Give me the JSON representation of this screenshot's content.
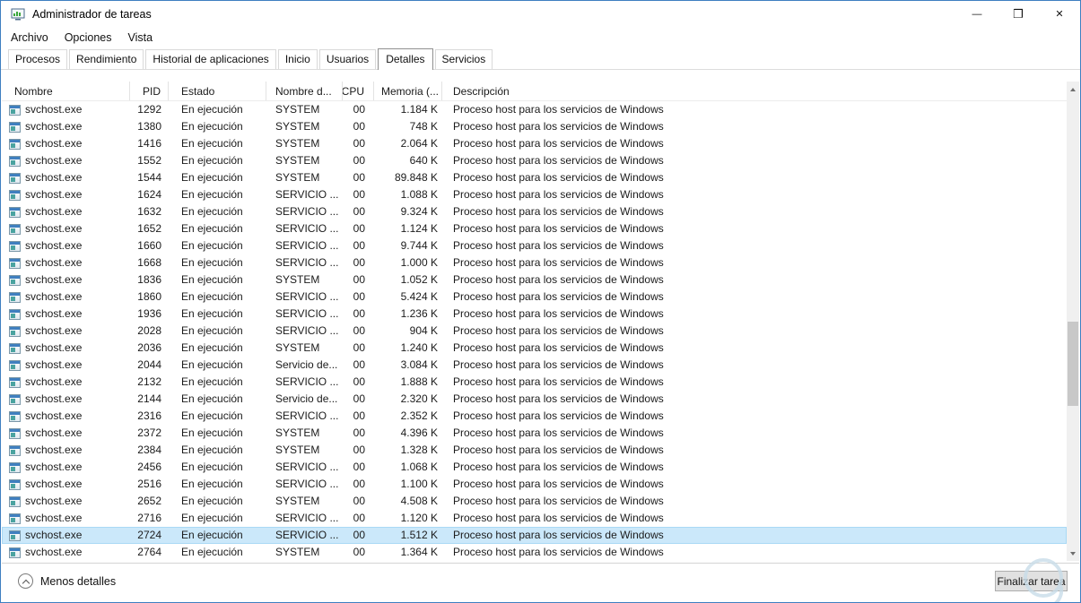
{
  "window": {
    "title": "Administrador de tareas",
    "controls": {
      "minimize": "—",
      "maximize": "❒",
      "close": "✕"
    }
  },
  "menu": {
    "items": [
      "Archivo",
      "Opciones",
      "Vista"
    ]
  },
  "tabs": {
    "items": [
      "Procesos",
      "Rendimiento",
      "Historial de aplicaciones",
      "Inicio",
      "Usuarios",
      "Detalles",
      "Servicios"
    ],
    "active": "Detalles"
  },
  "table": {
    "columns": [
      "Nombre",
      "PID",
      "Estado",
      "Nombre d...",
      "CPU",
      "Memoria (...",
      "Descripción"
    ],
    "sort": {
      "column": "Nombre",
      "direction": "asc",
      "glyph": "ˆ"
    },
    "rows": [
      {
        "name": "svchost.exe",
        "pid": "1292",
        "status": "En ejecución",
        "user": "SYSTEM",
        "cpu": "00",
        "memory": "1.184 K",
        "description": "Proceso host para los servicios de Windows",
        "selected": false
      },
      {
        "name": "svchost.exe",
        "pid": "1380",
        "status": "En ejecución",
        "user": "SYSTEM",
        "cpu": "00",
        "memory": "748 K",
        "description": "Proceso host para los servicios de Windows",
        "selected": false
      },
      {
        "name": "svchost.exe",
        "pid": "1416",
        "status": "En ejecución",
        "user": "SYSTEM",
        "cpu": "00",
        "memory": "2.064 K",
        "description": "Proceso host para los servicios de Windows",
        "selected": false
      },
      {
        "name": "svchost.exe",
        "pid": "1552",
        "status": "En ejecución",
        "user": "SYSTEM",
        "cpu": "00",
        "memory": "640 K",
        "description": "Proceso host para los servicios de Windows",
        "selected": false
      },
      {
        "name": "svchost.exe",
        "pid": "1544",
        "status": "En ejecución",
        "user": "SYSTEM",
        "cpu": "00",
        "memory": "89.848 K",
        "description": "Proceso host para los servicios de Windows",
        "selected": false
      },
      {
        "name": "svchost.exe",
        "pid": "1624",
        "status": "En ejecución",
        "user": "SERVICIO ...",
        "cpu": "00",
        "memory": "1.088 K",
        "description": "Proceso host para los servicios de Windows",
        "selected": false
      },
      {
        "name": "svchost.exe",
        "pid": "1632",
        "status": "En ejecución",
        "user": "SERVICIO ...",
        "cpu": "00",
        "memory": "9.324 K",
        "description": "Proceso host para los servicios de Windows",
        "selected": false
      },
      {
        "name": "svchost.exe",
        "pid": "1652",
        "status": "En ejecución",
        "user": "SERVICIO ...",
        "cpu": "00",
        "memory": "1.124 K",
        "description": "Proceso host para los servicios de Windows",
        "selected": false
      },
      {
        "name": "svchost.exe",
        "pid": "1660",
        "status": "En ejecución",
        "user": "SERVICIO ...",
        "cpu": "00",
        "memory": "9.744 K",
        "description": "Proceso host para los servicios de Windows",
        "selected": false
      },
      {
        "name": "svchost.exe",
        "pid": "1668",
        "status": "En ejecución",
        "user": "SERVICIO ...",
        "cpu": "00",
        "memory": "1.000 K",
        "description": "Proceso host para los servicios de Windows",
        "selected": false
      },
      {
        "name": "svchost.exe",
        "pid": "1836",
        "status": "En ejecución",
        "user": "SYSTEM",
        "cpu": "00",
        "memory": "1.052 K",
        "description": "Proceso host para los servicios de Windows",
        "selected": false
      },
      {
        "name": "svchost.exe",
        "pid": "1860",
        "status": "En ejecución",
        "user": "SERVICIO ...",
        "cpu": "00",
        "memory": "5.424 K",
        "description": "Proceso host para los servicios de Windows",
        "selected": false
      },
      {
        "name": "svchost.exe",
        "pid": "1936",
        "status": "En ejecución",
        "user": "SERVICIO ...",
        "cpu": "00",
        "memory": "1.236 K",
        "description": "Proceso host para los servicios de Windows",
        "selected": false
      },
      {
        "name": "svchost.exe",
        "pid": "2028",
        "status": "En ejecución",
        "user": "SERVICIO ...",
        "cpu": "00",
        "memory": "904 K",
        "description": "Proceso host para los servicios de Windows",
        "selected": false
      },
      {
        "name": "svchost.exe",
        "pid": "2036",
        "status": "En ejecución",
        "user": "SYSTEM",
        "cpu": "00",
        "memory": "1.240 K",
        "description": "Proceso host para los servicios de Windows",
        "selected": false
      },
      {
        "name": "svchost.exe",
        "pid": "2044",
        "status": "En ejecución",
        "user": "Servicio de...",
        "cpu": "00",
        "memory": "3.084 K",
        "description": "Proceso host para los servicios de Windows",
        "selected": false
      },
      {
        "name": "svchost.exe",
        "pid": "2132",
        "status": "En ejecución",
        "user": "SERVICIO ...",
        "cpu": "00",
        "memory": "1.888 K",
        "description": "Proceso host para los servicios de Windows",
        "selected": false
      },
      {
        "name": "svchost.exe",
        "pid": "2144",
        "status": "En ejecución",
        "user": "Servicio de...",
        "cpu": "00",
        "memory": "2.320 K",
        "description": "Proceso host para los servicios de Windows",
        "selected": false
      },
      {
        "name": "svchost.exe",
        "pid": "2316",
        "status": "En ejecución",
        "user": "SERVICIO ...",
        "cpu": "00",
        "memory": "2.352 K",
        "description": "Proceso host para los servicios de Windows",
        "selected": false
      },
      {
        "name": "svchost.exe",
        "pid": "2372",
        "status": "En ejecución",
        "user": "SYSTEM",
        "cpu": "00",
        "memory": "4.396 K",
        "description": "Proceso host para los servicios de Windows",
        "selected": false
      },
      {
        "name": "svchost.exe",
        "pid": "2384",
        "status": "En ejecución",
        "user": "SYSTEM",
        "cpu": "00",
        "memory": "1.328 K",
        "description": "Proceso host para los servicios de Windows",
        "selected": false
      },
      {
        "name": "svchost.exe",
        "pid": "2456",
        "status": "En ejecución",
        "user": "SERVICIO ...",
        "cpu": "00",
        "memory": "1.068 K",
        "description": "Proceso host para los servicios de Windows",
        "selected": false
      },
      {
        "name": "svchost.exe",
        "pid": "2516",
        "status": "En ejecución",
        "user": "SERVICIO ...",
        "cpu": "00",
        "memory": "1.100 K",
        "description": "Proceso host para los servicios de Windows",
        "selected": false
      },
      {
        "name": "svchost.exe",
        "pid": "2652",
        "status": "En ejecución",
        "user": "SYSTEM",
        "cpu": "00",
        "memory": "4.508 K",
        "description": "Proceso host para los servicios de Windows",
        "selected": false
      },
      {
        "name": "svchost.exe",
        "pid": "2716",
        "status": "En ejecución",
        "user": "SERVICIO ...",
        "cpu": "00",
        "memory": "1.120 K",
        "description": "Proceso host para los servicios de Windows",
        "selected": false
      },
      {
        "name": "svchost.exe",
        "pid": "2724",
        "status": "En ejecución",
        "user": "SERVICIO ...",
        "cpu": "00",
        "memory": "1.512 K",
        "description": "Proceso host para los servicios de Windows",
        "selected": true
      },
      {
        "name": "svchost.exe",
        "pid": "2764",
        "status": "En ejecución",
        "user": "SYSTEM",
        "cpu": "00",
        "memory": "1.364 K",
        "description": "Proceso host para los servicios de Windows",
        "selected": false
      }
    ]
  },
  "footer": {
    "less_details_label": "Menos detalles",
    "end_task_label": "Finalizar tarea"
  },
  "colors": {
    "window_border": "#3e7fc1",
    "accent": "#0078d7",
    "selection_bg": "#cbe8fa",
    "button_face": "#e1e1e1",
    "button_border": "#adadad"
  }
}
